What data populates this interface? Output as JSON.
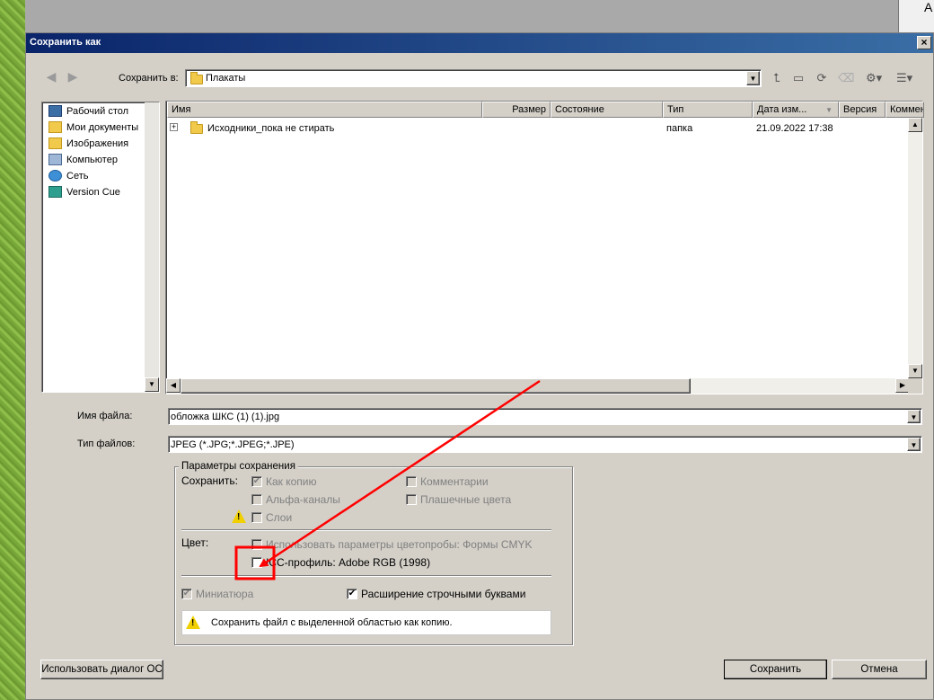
{
  "dialog": {
    "title": "Сохранить как",
    "close_glyph": "×"
  },
  "background": {
    "corner_letter": "A"
  },
  "toolbar": {
    "save_in_label": "Сохранить в:",
    "path_value": "Плакаты"
  },
  "places": [
    {
      "label": "Рабочий стол",
      "icon": "desktop-icon"
    },
    {
      "label": "Мои документы",
      "icon": "documents-icon"
    },
    {
      "label": "Изображения",
      "icon": "pictures-icon"
    },
    {
      "label": "Компьютер",
      "icon": "computer-icon"
    },
    {
      "label": "Сеть",
      "icon": "network-icon"
    },
    {
      "label": "Version Cue",
      "icon": "version-cue-icon"
    }
  ],
  "filelist": {
    "columns": [
      "Имя",
      "Размер",
      "Состояние",
      "Тип",
      "Дата изм...",
      "Версия",
      "Коммен"
    ],
    "rows": [
      {
        "name": "Исходники_пока не стирать",
        "size": "",
        "state": "",
        "type": "папка",
        "date": "21.09.2022 17:38"
      }
    ]
  },
  "form": {
    "filename_label": "Имя файла:",
    "filename_value": "обложка ШКС (1) (1).jpg",
    "filetype_label": "Тип файлов:",
    "filetype_value": "JPEG (*.JPG;*.JPEG;*.JPE)"
  },
  "options": {
    "group_title": "Параметры сохранения",
    "save_label": "Сохранить:",
    "as_copy": "Как копию",
    "alpha": "Альфа-каналы",
    "layers": "Слои",
    "comments": "Комментарии",
    "spot": "Плашечные цвета",
    "color_label": "Цвет:",
    "proof": "Использовать параметры цветопробы:  Формы CMYK",
    "icc": "ICC-профиль:  Adobe RGB (1998)",
    "thumbnail": "Миниатюра",
    "lowercase": "Расширение строчными буквами",
    "warning": "Сохранить файл с выделенной областью как копию."
  },
  "buttons": {
    "use_os_dialog": "Использовать диалог ОС",
    "save": "Сохранить",
    "cancel": "Отмена"
  },
  "colors": {
    "dialog_bg": "#d4d0c8",
    "title_gradient": "#0a246a",
    "annotation_red": "#ff0000"
  }
}
